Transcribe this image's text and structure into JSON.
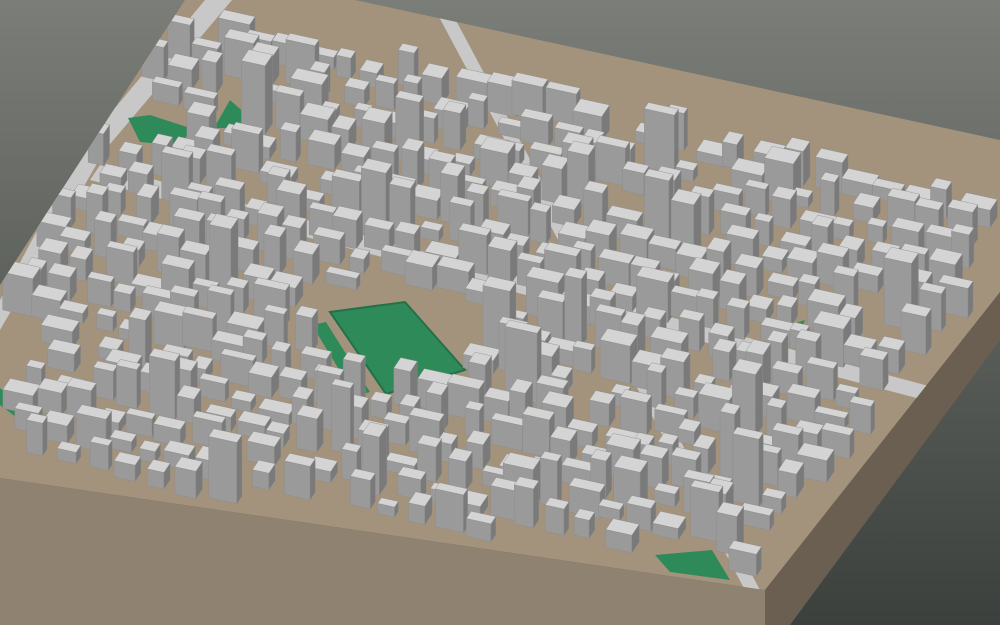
{
  "scene": {
    "kind": "3d-city-block-model",
    "projection": "oblique-isometric",
    "colors": {
      "background_top": "#7b7e78",
      "background_bottom": "#3c403d",
      "ground": "#a4937c",
      "ground_side_front": "#8f8270",
      "ground_side_right": "#6a5f51",
      "roof": "#d4d4d4",
      "wall_left": "#9a9a9a",
      "wall_right": "#7a7a7a",
      "park": "#2f8a5a",
      "park_edge": "#247048",
      "road": "#c8c8c8"
    },
    "features": [
      {
        "type": "park",
        "name": "central-park"
      },
      {
        "type": "park",
        "name": "northwest-park-a"
      },
      {
        "type": "park",
        "name": "northwest-park-b"
      },
      {
        "type": "park",
        "name": "west-edge-park"
      },
      {
        "type": "park",
        "name": "south-edge-park"
      },
      {
        "type": "road",
        "name": "diagonal-avenue"
      },
      {
        "type": "road",
        "name": "central-street"
      }
    ]
  }
}
